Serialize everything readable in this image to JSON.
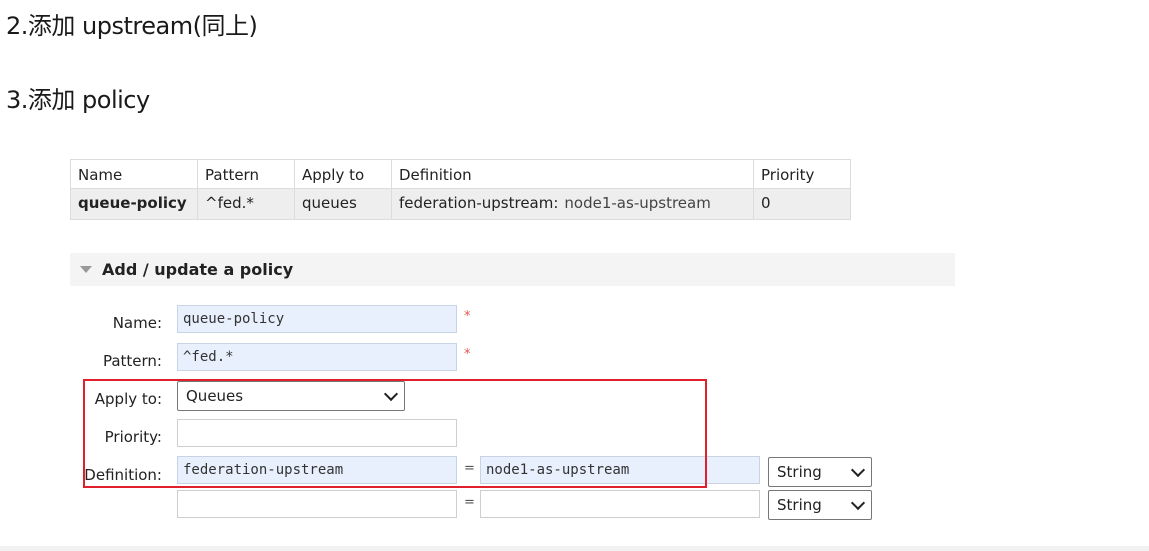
{
  "headings": {
    "step2": "2.添加 upstream(同上)",
    "step3": "3.添加 policy"
  },
  "policy_table": {
    "columns": [
      "Name",
      "Pattern",
      "Apply to",
      "Definition",
      "Priority"
    ],
    "rows": [
      {
        "name": "queue-policy",
        "pattern": "^fed.*",
        "apply_to": "queues",
        "definition_key": "federation-upstream:",
        "definition_value": "node1-as-upstream",
        "priority": "0"
      }
    ]
  },
  "form": {
    "section_title": "Add / update a policy",
    "name_label": "Name:",
    "name_value": "queue-policy",
    "pattern_label": "Pattern:",
    "pattern_value": "^fed.*",
    "required_mark": "*",
    "apply_to_label": "Apply to:",
    "apply_to_value": "Queues",
    "priority_label": "Priority:",
    "priority_value": "",
    "definition_label": "Definition:",
    "definitions": [
      {
        "key": "federation-upstream",
        "value": "node1-as-upstream",
        "type": "String"
      },
      {
        "key": "",
        "value": "",
        "type": "String"
      }
    ],
    "equals": "="
  },
  "colors": {
    "highlight": "#e0202a",
    "input_fill": "#e8f0fe",
    "required": "#e05555"
  }
}
